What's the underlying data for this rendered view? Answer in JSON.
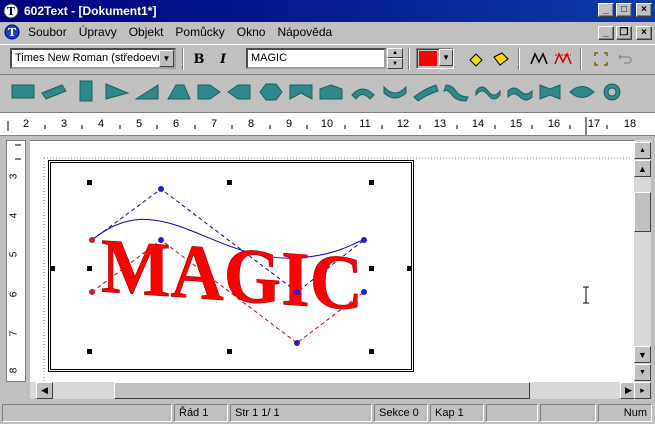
{
  "app": {
    "title": "602Text - [Dokument1*]"
  },
  "window_controls": {
    "minimize": "_",
    "maximize": "□",
    "close": "×",
    "restore": "❐"
  },
  "menu": {
    "items": [
      "Soubor",
      "Úpravy",
      "Objekt",
      "Pomůcky",
      "Okno",
      "Nápověda"
    ]
  },
  "toolbar": {
    "font_value": "Times New Roman (středoevro",
    "bold_label": "B",
    "italic_label": "I",
    "text_value": "MAGIC",
    "color": "#ff0000"
  },
  "shapes": {
    "items": [
      "rectangle-shape",
      "parallelogram-shape",
      "tall-rect-shape",
      "right-triangle-shape",
      "ramp-shape",
      "trapezoid-shape",
      "arrow-right-shape",
      "arrow-left-shape",
      "hexagon-shape",
      "notch-bottom-shape",
      "notch-top-shape",
      "arch-up-shape",
      "arch-down-shape",
      "slant-curve-shape",
      "wave-left-shape",
      "wave-shape",
      "double-wave-shape",
      "bowtie-shape",
      "diamond-lens-shape",
      "ring-shape"
    ]
  },
  "ruler": {
    "labels": [
      "2",
      "3",
      "4",
      "5",
      "6",
      "7",
      "8",
      "9",
      "10",
      "11",
      "12",
      "13",
      "14",
      "15",
      "16",
      "17",
      "18"
    ],
    "vertical_labels": [
      "3",
      "4",
      "5",
      "6",
      "7",
      "8"
    ]
  },
  "document": {
    "text": "MAGIC",
    "text_color": "#ff0000"
  },
  "status": {
    "row": "Řád  1",
    "page": "Str   1     1/  1",
    "section": "Sekce 0",
    "column": "Kap   1",
    "mode": "Num"
  }
}
